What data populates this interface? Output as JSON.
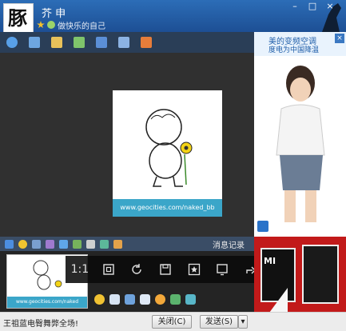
{
  "window": {
    "avatar_glyph": "豚",
    "nickname": "芥 申",
    "signature": "做快乐的自己",
    "controls": [
      "–",
      "□",
      "×"
    ]
  },
  "toolbar": {
    "icons": [
      "video-call-icon",
      "voice-call-icon",
      "file-transfer-icon",
      "message-icon",
      "remote-assist-icon",
      "screen-share-icon",
      "apps-icon"
    ]
  },
  "ad_right": {
    "line1": "美的变频空调",
    "line2": "度电为中国降温",
    "close": "×"
  },
  "chat_image": {
    "caption": "www.geocities.com/naked_bb"
  },
  "format_bar": {
    "more_label": "消息记录"
  },
  "thumb": {
    "caption": "www.geocities.com/naked"
  },
  "viewer": {
    "ratio_label": "1:1"
  },
  "ad_bottom": {
    "brand": "MI"
  },
  "footer": {
    "ticker": "王祖蓝电臀舞弊全场!",
    "close_label": "关闭(C)",
    "send_label": "发送(S)"
  },
  "colors": {
    "titlebar": "#2c6db7",
    "accent": "#3ba6c9",
    "ad_red": "#c21a1a"
  }
}
